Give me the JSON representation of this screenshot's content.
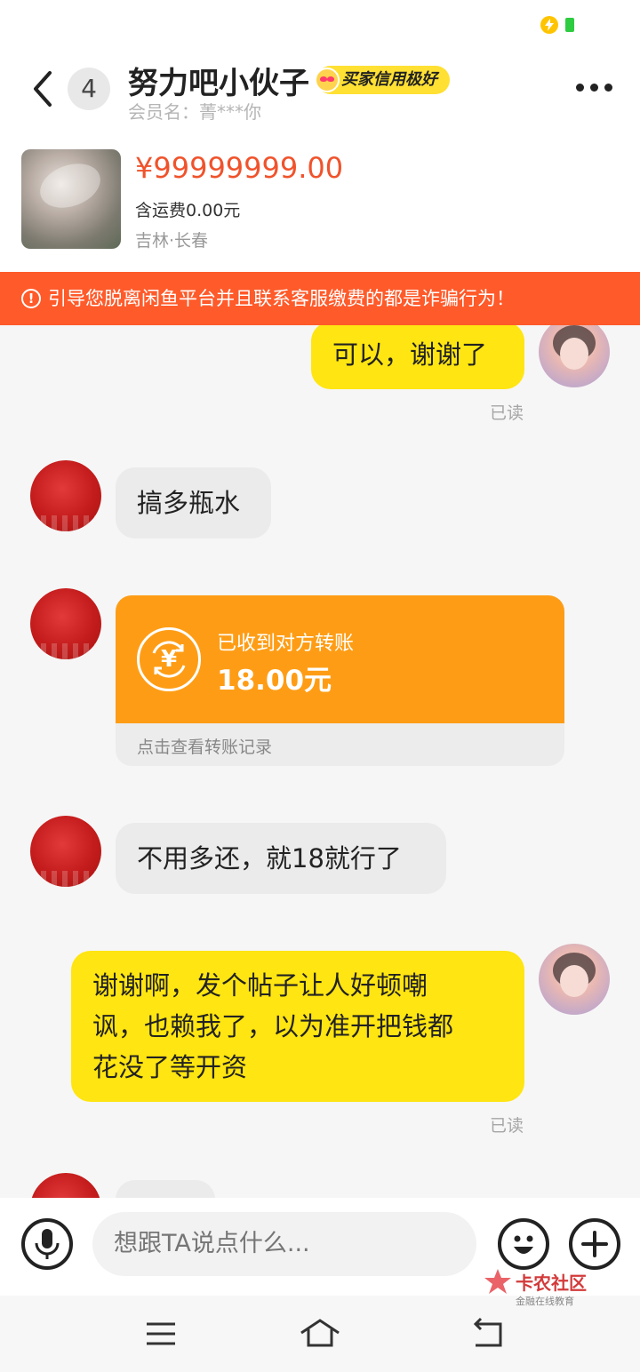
{
  "header": {
    "unread_count": "4",
    "title": "努力吧小伙子",
    "credit_badge": "买家信用极好",
    "member_name": "会员名：菁***你"
  },
  "product": {
    "price": "¥99999999.00",
    "shipping": "含运费0.00元",
    "location": "吉林·长春"
  },
  "warning": {
    "icon_char": "!",
    "text": "引导您脱离闲鱼平台并且联系客服缴费的都是诈骗行为！"
  },
  "messages": [
    {
      "from": "self",
      "text": "可以，谢谢了",
      "status": "已读"
    },
    {
      "from": "other",
      "text": "搞多瓶水"
    },
    {
      "from": "other",
      "type": "transfer",
      "label": "已收到对方转账",
      "amount": "18.00元",
      "link": "点击查看转账记录",
      "icon_char": "¥"
    },
    {
      "from": "other",
      "text": "不用多还，就18就行了"
    },
    {
      "from": "self",
      "lines": [
        "谢谢啊，发个帖子让人好顿嘲",
        "讽，也赖我了，以为准开把钱都",
        "花没了等开资"
      ],
      "status": "已读"
    }
  ],
  "input": {
    "placeholder": "想跟TA说点什么..."
  },
  "watermark": {
    "title": "卡农社区",
    "subtitle": "金融在线教育"
  },
  "colors": {
    "accent_yellow": "#ffe511",
    "warning_orange": "#ff5a2a",
    "price_red": "#f0532c",
    "transfer_orange": "#fe9d15"
  },
  "icons": {
    "status": [
      "charging-icon",
      "battery-icon"
    ],
    "header": [
      "back-arrow-icon",
      "more-icon"
    ],
    "input": [
      "microphone-icon",
      "emoji-icon",
      "plus-icon"
    ],
    "nav": [
      "menu-icon",
      "home-icon",
      "back-icon"
    ]
  }
}
